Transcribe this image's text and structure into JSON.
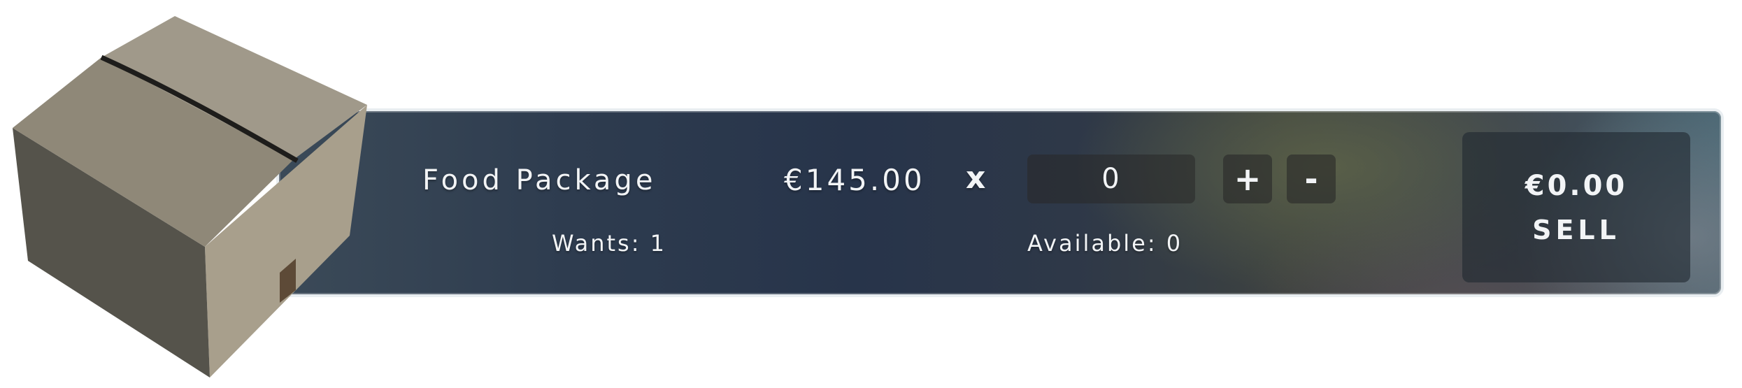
{
  "item": {
    "name": "Food Package",
    "wants_label": "Wants: 1",
    "icon": "cardboard-box-icon"
  },
  "pricing": {
    "unit_price": "€145.00",
    "multiplier_symbol": "x"
  },
  "quantity": {
    "value": "0",
    "increment_label": "+",
    "decrement_label": "-",
    "available_label": "Available: 0"
  },
  "sell": {
    "total": "€0.00",
    "label": "SELL"
  },
  "colors": {
    "panel_border": "#e9eef1",
    "panel_dark": "#27344a",
    "text": "#f2f4f6"
  }
}
